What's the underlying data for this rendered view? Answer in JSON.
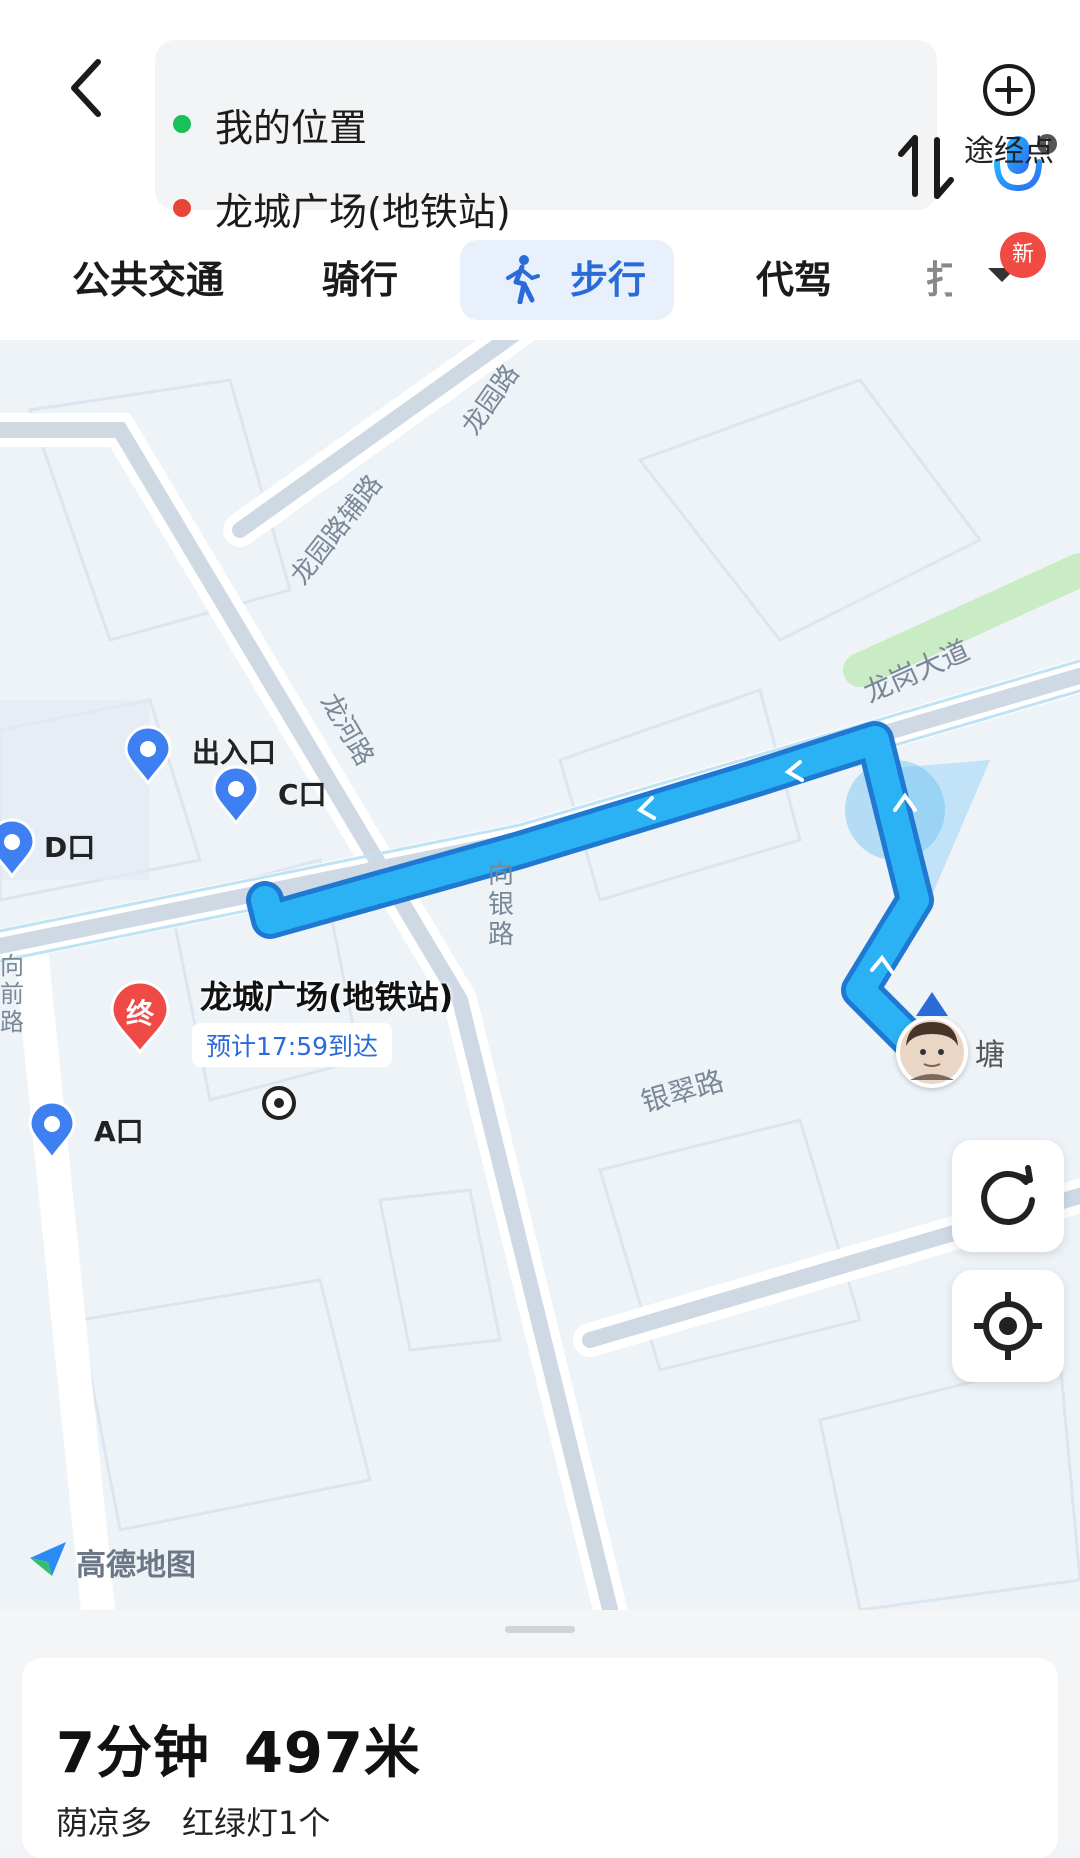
{
  "route": {
    "origin": "我的位置",
    "destination": "龙城广场(地铁站)",
    "origin_color": "#19c15a",
    "destination_color": "#e94536"
  },
  "waypoint_label": "途经点",
  "mode_tabs": [
    {
      "label": "公共交通",
      "active": false
    },
    {
      "label": "骑行",
      "active": false
    },
    {
      "label": "步行",
      "active": true,
      "icon": "walking-person-icon"
    },
    {
      "label": "代驾",
      "active": false
    },
    {
      "label": "打",
      "active": false,
      "partial": true
    }
  ],
  "new_badge": "新",
  "accent_color": "#2a6bd8",
  "map": {
    "roads": [
      "龙园路",
      "龙园路辅路",
      "龙河路",
      "龙岗大道",
      "向银路",
      "银翠路",
      "向前路"
    ],
    "markers": [
      {
        "label": "出入口"
      },
      {
        "label": "C口"
      },
      {
        "label": "D口"
      },
      {
        "label": "A口"
      }
    ],
    "end_marker": "终",
    "destination_label": "龙城广场(地铁站)",
    "eta_label": "预计17:59到达",
    "poi_label": "塘",
    "logo": "高德地图",
    "route_color": "#20a8f0"
  },
  "summary": {
    "duration": "7分钟",
    "distance": "497米",
    "tags": [
      "荫凉多",
      "红绿灯1个"
    ]
  }
}
